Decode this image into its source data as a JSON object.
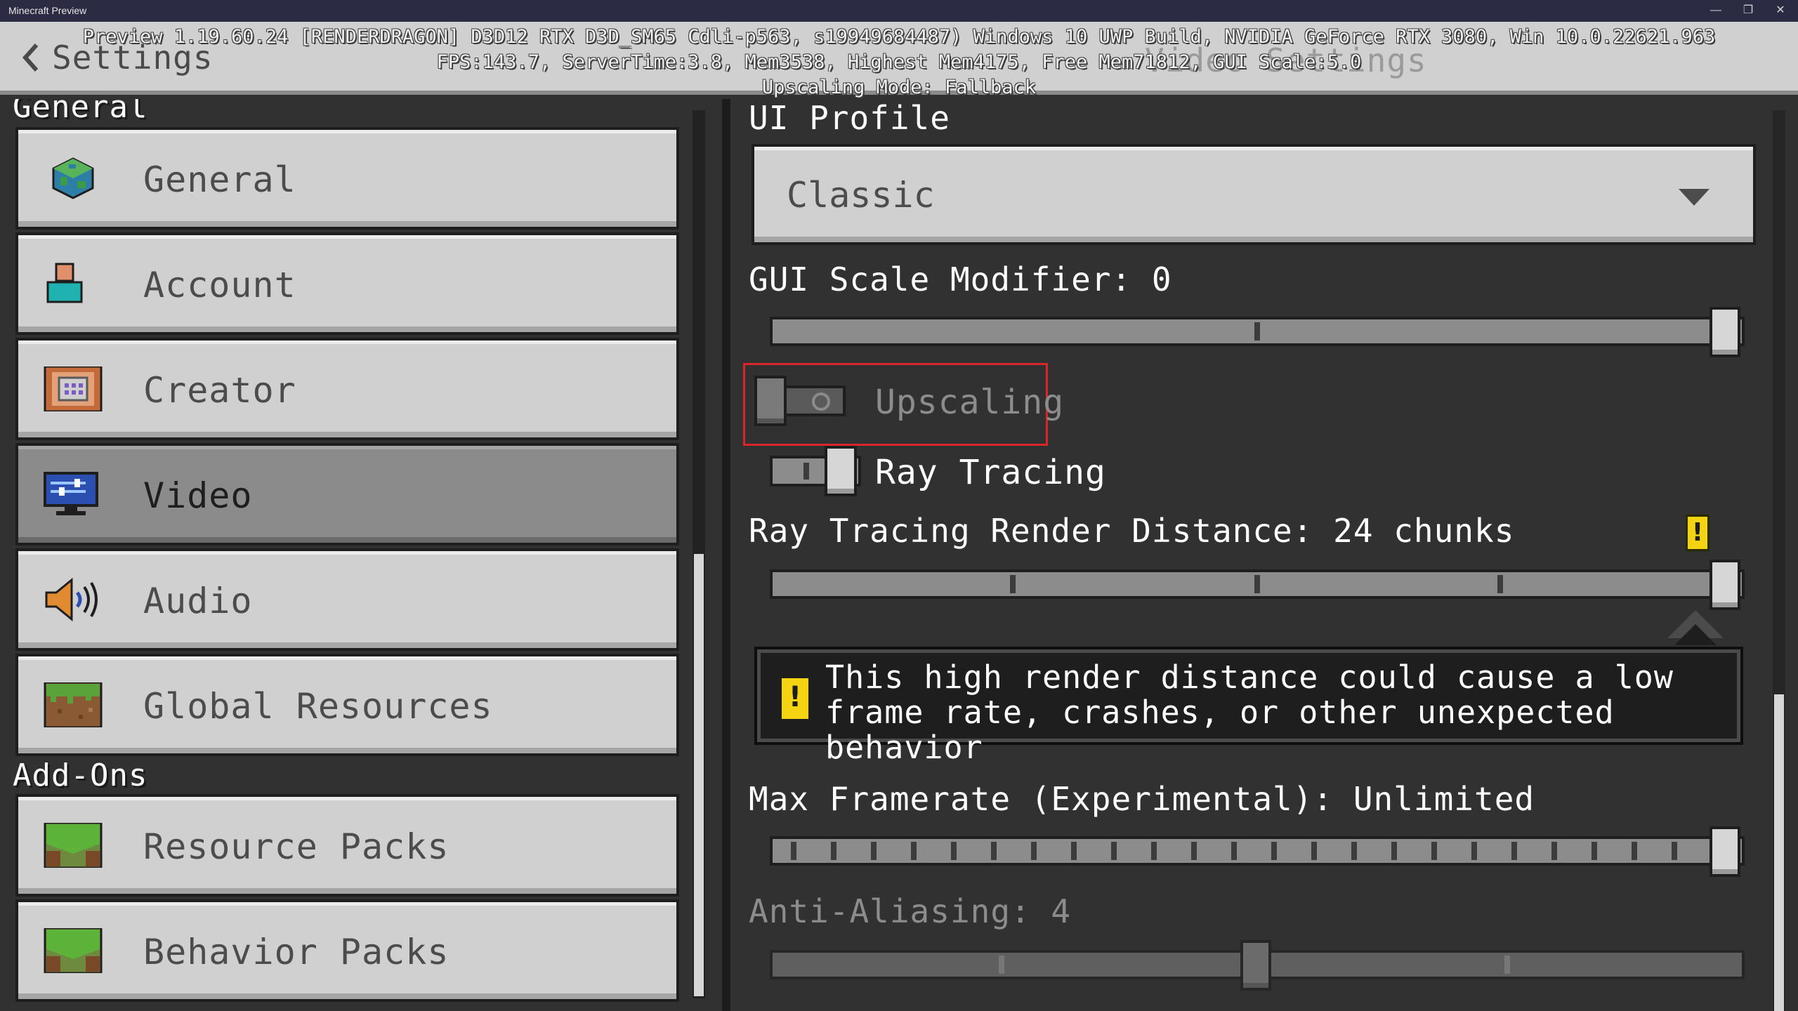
{
  "window": {
    "title": "Minecraft Preview",
    "controls": [
      "—",
      "❐",
      "✕"
    ]
  },
  "header": {
    "back_label": "Settings",
    "ghost_title": "Video Settings",
    "debug_lines": [
      "Preview 1.19.60.24 [RENDERDRAGON] D3D12 RTX D3D_SM65 Cdli-p563, s19949684487) Windows 10 UWP Build, NVIDIA GeForce RTX 3080, Win 10.0.22621.963",
      "FPS:143.7, ServerTime:3.8, Mem3538, Highest Mem4175, Free Mem71812, GUI Scale:5.0",
      "Upscaling Mode: Fallback"
    ]
  },
  "sidebar": {
    "sections": [
      {
        "title": "General",
        "items": [
          {
            "label": "General",
            "icon": "globe-icon",
            "selected": false
          },
          {
            "label": "Account",
            "icon": "account-icon",
            "selected": false
          },
          {
            "label": "Creator",
            "icon": "command-block-icon",
            "selected": false
          },
          {
            "label": "Video",
            "icon": "monitor-icon",
            "selected": true
          },
          {
            "label": "Audio",
            "icon": "speaker-icon",
            "selected": false
          },
          {
            "label": "Global Resources",
            "icon": "grass-block-icon",
            "selected": false
          }
        ]
      },
      {
        "title": "Add-Ons",
        "items": [
          {
            "label": "Resource Packs",
            "icon": "grass-block-icon",
            "selected": false
          },
          {
            "label": "Behavior Packs",
            "icon": "grass-block-icon",
            "selected": false
          }
        ]
      }
    ]
  },
  "content": {
    "ui_profile": {
      "label": "UI Profile",
      "value": "Classic"
    },
    "gui_scale": {
      "label": "GUI Scale Modifier: 0",
      "value": 0,
      "fraction": 1.0
    },
    "upscaling": {
      "label": "Upscaling",
      "on": false,
      "enabled": false
    },
    "ray_tracing": {
      "label": "Ray Tracing",
      "on": true
    },
    "rt_distance": {
      "label": "Ray Tracing Render Distance: 24 chunks",
      "fraction": 1.0
    },
    "warning_icon": "!",
    "tooltip": {
      "text": "This high render distance could cause a low frame rate, crashes, or other unexpected behavior"
    },
    "max_framerate": {
      "label": "Max Framerate (Experimental): Unlimited",
      "fraction": 1.0
    },
    "anti_aliasing": {
      "label": "Anti-Aliasing: 4",
      "fraction": 0.5,
      "enabled": false
    }
  },
  "colors": {
    "accent_warning": "#f3d312",
    "highlight_box": "#d8262d",
    "panel_bg": "#313131",
    "button_bg": "#d0d0d0",
    "selected_bg": "#8b8b8b"
  }
}
